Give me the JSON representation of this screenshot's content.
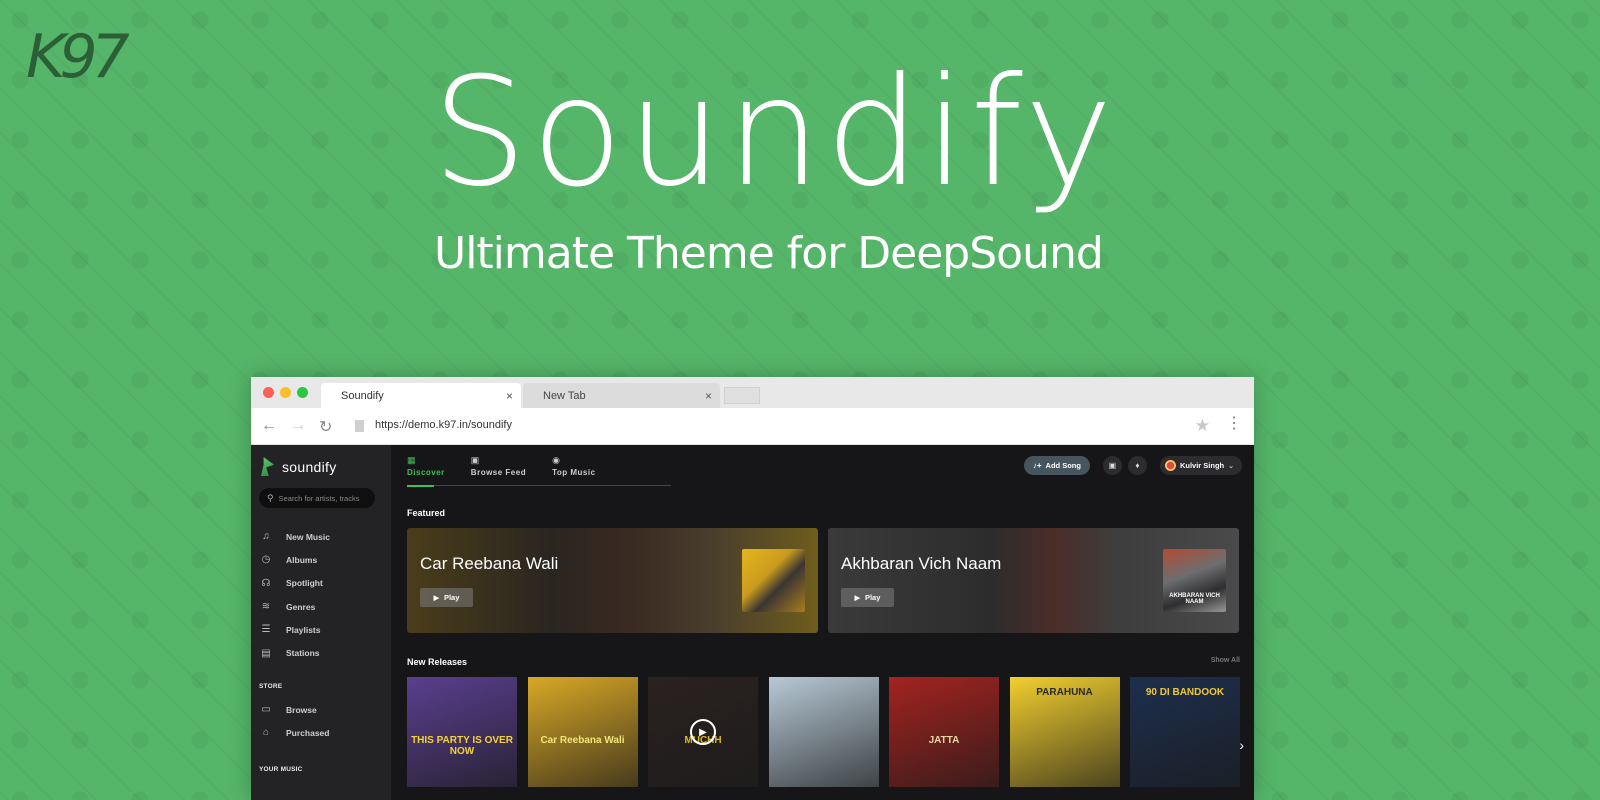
{
  "watermark": "K97",
  "hero": {
    "title": "Soundify",
    "subtitle": "Ultimate Theme for DeepSound"
  },
  "browser": {
    "tabs": [
      {
        "label": "Soundify",
        "active": true
      },
      {
        "label": "New Tab",
        "active": false
      }
    ],
    "close_glyph": "×",
    "url": "https://demo.k97.in/soundify",
    "icons": {
      "back": "←",
      "forward": "→",
      "reload": "↻",
      "star": "★",
      "menu": "⋮"
    }
  },
  "app": {
    "brand": "soundify",
    "search_placeholder": "Search for artists, tracks",
    "nav": [
      {
        "label": "New Music",
        "icon": "♫"
      },
      {
        "label": "Albums",
        "icon": "◷"
      },
      {
        "label": "Spotlight",
        "icon": "☊"
      },
      {
        "label": "Genres",
        "icon": "≋"
      },
      {
        "label": "Playlists",
        "icon": "☰"
      },
      {
        "label": "Stations",
        "icon": "▤"
      }
    ],
    "store_label": "STORE",
    "store": [
      {
        "label": "Browse",
        "icon": "▭"
      },
      {
        "label": "Purchased",
        "icon": "⌂"
      }
    ],
    "your_music_label": "YOUR MUSIC",
    "top_tabs": [
      {
        "label": "Discover",
        "icon": "▦",
        "active": true
      },
      {
        "label": "Browse Feed",
        "icon": "▣",
        "active": false
      },
      {
        "label": "Top Music",
        "icon": "◉",
        "active": false
      }
    ],
    "actions": {
      "add_song": "Add Song",
      "add_song_icon": "♪+",
      "store_icon": "▣",
      "bell_icon": "🔔",
      "user_name": "Kulvir Singh",
      "user_chevron": "⌄"
    },
    "featured_heading": "Featured",
    "featured": [
      {
        "title": "Car Reebana Wali",
        "play": "Play",
        "cover_text": ""
      },
      {
        "title": "Akhbaran Vich Naam",
        "play": "Play",
        "cover_text": "AKHBARAN VICH NAAM"
      }
    ],
    "play_icon": "▶",
    "new_releases_heading": "New Releases",
    "show_all": "Show All",
    "releases": [
      {
        "title": "THIS PARTY IS OVER NOW",
        "bg": "#5a3f8f",
        "fg": "#f4d23a"
      },
      {
        "title": "Car Reebana Wali",
        "bg": "#d9a826",
        "fg": "#f2e67a"
      },
      {
        "title": "MUCHH",
        "bg": "#2a2220",
        "fg": "#d9b82a"
      },
      {
        "title": "",
        "bg": "#b7c9d6",
        "fg": "#fff"
      },
      {
        "title": "JATTA",
        "bg": "#a3231f",
        "fg": "#e9d7a6"
      },
      {
        "title": "PARAHUNA",
        "bg": "#f2cf2f",
        "fg": "#2a2a2a"
      },
      {
        "title": "90 DI BANDOOK",
        "bg": "#1d2f4e",
        "fg": "#f0c93a"
      }
    ],
    "next_icon": "›"
  },
  "colors": {
    "background": "#55b569",
    "accent": "#3fbe58",
    "sidebar": "#232326",
    "main": "#161618"
  }
}
